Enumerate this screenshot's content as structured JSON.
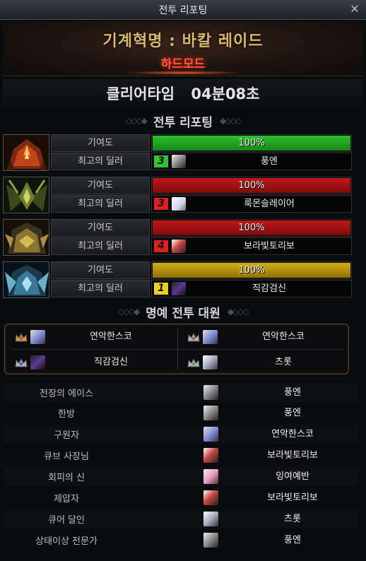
{
  "window": {
    "title": "전투 리포팅",
    "close_icon": "close-icon"
  },
  "raid": {
    "name": "기계혁명 : 바칼 레이드",
    "mode": "하드모드"
  },
  "clear": {
    "label": "클리어타임",
    "time": "04분08초"
  },
  "report": {
    "title": "전투 리포팅",
    "contribution_label": "기여도",
    "top_dealer_label": "최고의 딜러",
    "bosses": [
      {
        "portrait_icon": "red-fire-boss-icon",
        "contribution": "100%",
        "contribution_fraction": 1.0,
        "bar_color": "#1f9a1f",
        "rank": "3",
        "rank_color": "#2fc42f",
        "dealer": "풍엔"
      },
      {
        "portrait_icon": "green-thorn-boss-icon",
        "contribution": "100%",
        "contribution_fraction": 1.0,
        "bar_color": "#a51010",
        "rank": "3",
        "rank_color": "#e02020",
        "dealer": "룩몬슬레이어"
      },
      {
        "portrait_icon": "gold-horn-boss-icon",
        "contribution": "100%",
        "contribution_fraction": 1.0,
        "bar_color": "#a51010",
        "rank": "4",
        "rank_color": "#e02020",
        "dealer": "보라빛토리보"
      },
      {
        "portrait_icon": "blue-ice-boss-icon",
        "contribution": "100%",
        "contribution_fraction": 1.0,
        "bar_color": "#b8950a",
        "rank": "1",
        "rank_color": "#e8d020",
        "dealer": "직감검신"
      }
    ]
  },
  "honor": {
    "title": "명예 전투 대원",
    "members": [
      {
        "name": "연악한스코"
      },
      {
        "name": "연악한스코"
      },
      {
        "name": "직감검신"
      },
      {
        "name": "츠롯"
      }
    ]
  },
  "awards": [
    {
      "title": "전장의 에이스",
      "player": "풍엔"
    },
    {
      "title": "한방",
      "player": "풍엔"
    },
    {
      "title": "구원자",
      "player": "연악한스코"
    },
    {
      "title": "큐브 사장님",
      "player": "보라빛토리보"
    },
    {
      "title": "회피의 신",
      "player": "잉여예반"
    },
    {
      "title": "제압자",
      "player": "보라빛토리보"
    },
    {
      "title": "큐어 달인",
      "player": "츠롯"
    },
    {
      "title": "상태이상 전문가",
      "player": "풍엔"
    }
  ]
}
